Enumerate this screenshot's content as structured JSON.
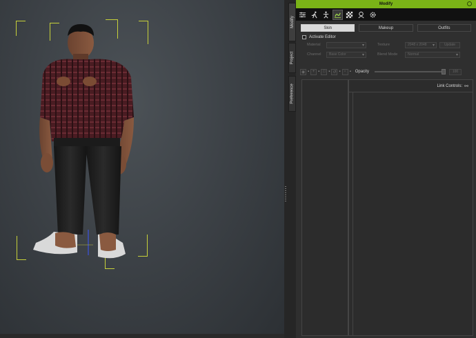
{
  "panel": {
    "title": "Modify",
    "vertical_tabs": [
      "Modify",
      "Project",
      "Preference"
    ],
    "toolbar_icons": [
      "sliders-icon",
      "running-figure-icon",
      "pose-figure-icon",
      "skin-layer-icon",
      "checker-texture-icon",
      "head-silhouette-icon",
      "gear-icon"
    ],
    "subtabs": [
      "Skin",
      "Makeup",
      "Outfits"
    ],
    "active_subtab": "Skin",
    "activate_label": "Activate Editor",
    "row1": {
      "label1": "Material",
      "value1": "",
      "label2": "Texture",
      "value2": "2048 x 2048",
      "button": "Update"
    },
    "row2": {
      "label1": "Channel",
      "value1": "Base Color",
      "label2": "Blend Mode",
      "value2": "Normal"
    },
    "opacity_label": "Opacity",
    "opacity_value": "100",
    "opacity_fraction": 1.0,
    "link_controls_label": "Link Controls:"
  },
  "colors": {
    "accent": "#7ab317",
    "selection": "#c8d23a"
  }
}
